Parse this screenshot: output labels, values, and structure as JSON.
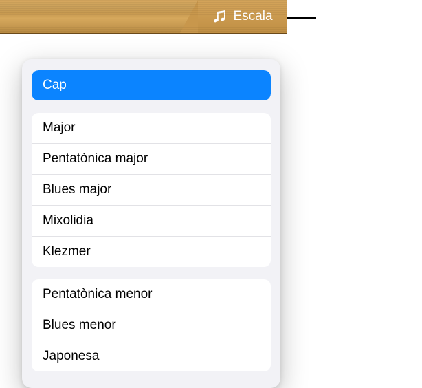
{
  "header": {
    "escala_label": "Escala"
  },
  "scales": {
    "selected": "Cap",
    "group1": [
      "Major",
      "Pentatònica major",
      "Blues major",
      "Mixolidia",
      "Klezmer"
    ],
    "group2": [
      "Pentatònica menor",
      "Blues menor",
      "Japonesa"
    ]
  }
}
